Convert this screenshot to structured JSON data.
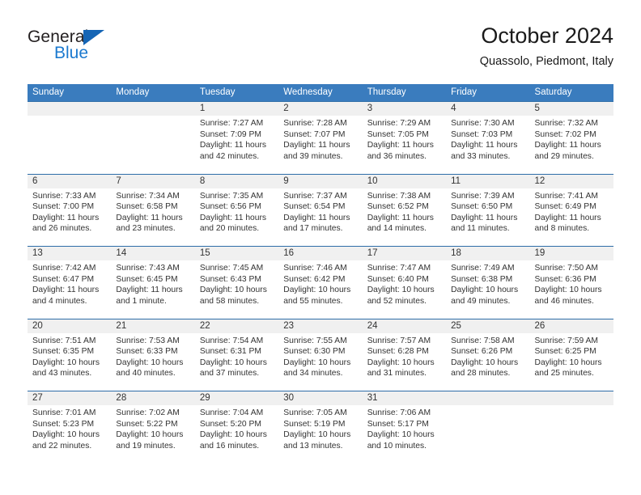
{
  "brand": {
    "name_top": "General",
    "name_bottom": "Blue",
    "accent_color": "#1b79cf",
    "triangle_color": "#1565b5"
  },
  "header": {
    "title": "October 2024",
    "subtitle": "Quassolo, Piedmont, Italy"
  },
  "calendar": {
    "header_bg": "#3a7cbe",
    "daynum_band_bg": "#f0f0f0",
    "week_rule_color": "#2e6da8",
    "weekdays": [
      "Sunday",
      "Monday",
      "Tuesday",
      "Wednesday",
      "Thursday",
      "Friday",
      "Saturday"
    ],
    "weeks": [
      [
        {
          "day": "",
          "sunrise": "",
          "sunset": "",
          "daylight_line1": "",
          "daylight_line2": ""
        },
        {
          "day": "",
          "sunrise": "",
          "sunset": "",
          "daylight_line1": "",
          "daylight_line2": ""
        },
        {
          "day": "1",
          "sunrise": "Sunrise: 7:27 AM",
          "sunset": "Sunset: 7:09 PM",
          "daylight_line1": "Daylight: 11 hours",
          "daylight_line2": "and 42 minutes."
        },
        {
          "day": "2",
          "sunrise": "Sunrise: 7:28 AM",
          "sunset": "Sunset: 7:07 PM",
          "daylight_line1": "Daylight: 11 hours",
          "daylight_line2": "and 39 minutes."
        },
        {
          "day": "3",
          "sunrise": "Sunrise: 7:29 AM",
          "sunset": "Sunset: 7:05 PM",
          "daylight_line1": "Daylight: 11 hours",
          "daylight_line2": "and 36 minutes."
        },
        {
          "day": "4",
          "sunrise": "Sunrise: 7:30 AM",
          "sunset": "Sunset: 7:03 PM",
          "daylight_line1": "Daylight: 11 hours",
          "daylight_line2": "and 33 minutes."
        },
        {
          "day": "5",
          "sunrise": "Sunrise: 7:32 AM",
          "sunset": "Sunset: 7:02 PM",
          "daylight_line1": "Daylight: 11 hours",
          "daylight_line2": "and 29 minutes."
        }
      ],
      [
        {
          "day": "6",
          "sunrise": "Sunrise: 7:33 AM",
          "sunset": "Sunset: 7:00 PM",
          "daylight_line1": "Daylight: 11 hours",
          "daylight_line2": "and 26 minutes."
        },
        {
          "day": "7",
          "sunrise": "Sunrise: 7:34 AM",
          "sunset": "Sunset: 6:58 PM",
          "daylight_line1": "Daylight: 11 hours",
          "daylight_line2": "and 23 minutes."
        },
        {
          "day": "8",
          "sunrise": "Sunrise: 7:35 AM",
          "sunset": "Sunset: 6:56 PM",
          "daylight_line1": "Daylight: 11 hours",
          "daylight_line2": "and 20 minutes."
        },
        {
          "day": "9",
          "sunrise": "Sunrise: 7:37 AM",
          "sunset": "Sunset: 6:54 PM",
          "daylight_line1": "Daylight: 11 hours",
          "daylight_line2": "and 17 minutes."
        },
        {
          "day": "10",
          "sunrise": "Sunrise: 7:38 AM",
          "sunset": "Sunset: 6:52 PM",
          "daylight_line1": "Daylight: 11 hours",
          "daylight_line2": "and 14 minutes."
        },
        {
          "day": "11",
          "sunrise": "Sunrise: 7:39 AM",
          "sunset": "Sunset: 6:50 PM",
          "daylight_line1": "Daylight: 11 hours",
          "daylight_line2": "and 11 minutes."
        },
        {
          "day": "12",
          "sunrise": "Sunrise: 7:41 AM",
          "sunset": "Sunset: 6:49 PM",
          "daylight_line1": "Daylight: 11 hours",
          "daylight_line2": "and 8 minutes."
        }
      ],
      [
        {
          "day": "13",
          "sunrise": "Sunrise: 7:42 AM",
          "sunset": "Sunset: 6:47 PM",
          "daylight_line1": "Daylight: 11 hours",
          "daylight_line2": "and 4 minutes."
        },
        {
          "day": "14",
          "sunrise": "Sunrise: 7:43 AM",
          "sunset": "Sunset: 6:45 PM",
          "daylight_line1": "Daylight: 11 hours",
          "daylight_line2": "and 1 minute."
        },
        {
          "day": "15",
          "sunrise": "Sunrise: 7:45 AM",
          "sunset": "Sunset: 6:43 PM",
          "daylight_line1": "Daylight: 10 hours",
          "daylight_line2": "and 58 minutes."
        },
        {
          "day": "16",
          "sunrise": "Sunrise: 7:46 AM",
          "sunset": "Sunset: 6:42 PM",
          "daylight_line1": "Daylight: 10 hours",
          "daylight_line2": "and 55 minutes."
        },
        {
          "day": "17",
          "sunrise": "Sunrise: 7:47 AM",
          "sunset": "Sunset: 6:40 PM",
          "daylight_line1": "Daylight: 10 hours",
          "daylight_line2": "and 52 minutes."
        },
        {
          "day": "18",
          "sunrise": "Sunrise: 7:49 AM",
          "sunset": "Sunset: 6:38 PM",
          "daylight_line1": "Daylight: 10 hours",
          "daylight_line2": "and 49 minutes."
        },
        {
          "day": "19",
          "sunrise": "Sunrise: 7:50 AM",
          "sunset": "Sunset: 6:36 PM",
          "daylight_line1": "Daylight: 10 hours",
          "daylight_line2": "and 46 minutes."
        }
      ],
      [
        {
          "day": "20",
          "sunrise": "Sunrise: 7:51 AM",
          "sunset": "Sunset: 6:35 PM",
          "daylight_line1": "Daylight: 10 hours",
          "daylight_line2": "and 43 minutes."
        },
        {
          "day": "21",
          "sunrise": "Sunrise: 7:53 AM",
          "sunset": "Sunset: 6:33 PM",
          "daylight_line1": "Daylight: 10 hours",
          "daylight_line2": "and 40 minutes."
        },
        {
          "day": "22",
          "sunrise": "Sunrise: 7:54 AM",
          "sunset": "Sunset: 6:31 PM",
          "daylight_line1": "Daylight: 10 hours",
          "daylight_line2": "and 37 minutes."
        },
        {
          "day": "23",
          "sunrise": "Sunrise: 7:55 AM",
          "sunset": "Sunset: 6:30 PM",
          "daylight_line1": "Daylight: 10 hours",
          "daylight_line2": "and 34 minutes."
        },
        {
          "day": "24",
          "sunrise": "Sunrise: 7:57 AM",
          "sunset": "Sunset: 6:28 PM",
          "daylight_line1": "Daylight: 10 hours",
          "daylight_line2": "and 31 minutes."
        },
        {
          "day": "25",
          "sunrise": "Sunrise: 7:58 AM",
          "sunset": "Sunset: 6:26 PM",
          "daylight_line1": "Daylight: 10 hours",
          "daylight_line2": "and 28 minutes."
        },
        {
          "day": "26",
          "sunrise": "Sunrise: 7:59 AM",
          "sunset": "Sunset: 6:25 PM",
          "daylight_line1": "Daylight: 10 hours",
          "daylight_line2": "and 25 minutes."
        }
      ],
      [
        {
          "day": "27",
          "sunrise": "Sunrise: 7:01 AM",
          "sunset": "Sunset: 5:23 PM",
          "daylight_line1": "Daylight: 10 hours",
          "daylight_line2": "and 22 minutes."
        },
        {
          "day": "28",
          "sunrise": "Sunrise: 7:02 AM",
          "sunset": "Sunset: 5:22 PM",
          "daylight_line1": "Daylight: 10 hours",
          "daylight_line2": "and 19 minutes."
        },
        {
          "day": "29",
          "sunrise": "Sunrise: 7:04 AM",
          "sunset": "Sunset: 5:20 PM",
          "daylight_line1": "Daylight: 10 hours",
          "daylight_line2": "and 16 minutes."
        },
        {
          "day": "30",
          "sunrise": "Sunrise: 7:05 AM",
          "sunset": "Sunset: 5:19 PM",
          "daylight_line1": "Daylight: 10 hours",
          "daylight_line2": "and 13 minutes."
        },
        {
          "day": "31",
          "sunrise": "Sunrise: 7:06 AM",
          "sunset": "Sunset: 5:17 PM",
          "daylight_line1": "Daylight: 10 hours",
          "daylight_line2": "and 10 minutes."
        },
        {
          "day": "",
          "sunrise": "",
          "sunset": "",
          "daylight_line1": "",
          "daylight_line2": ""
        },
        {
          "day": "",
          "sunrise": "",
          "sunset": "",
          "daylight_line1": "",
          "daylight_line2": ""
        }
      ]
    ]
  }
}
